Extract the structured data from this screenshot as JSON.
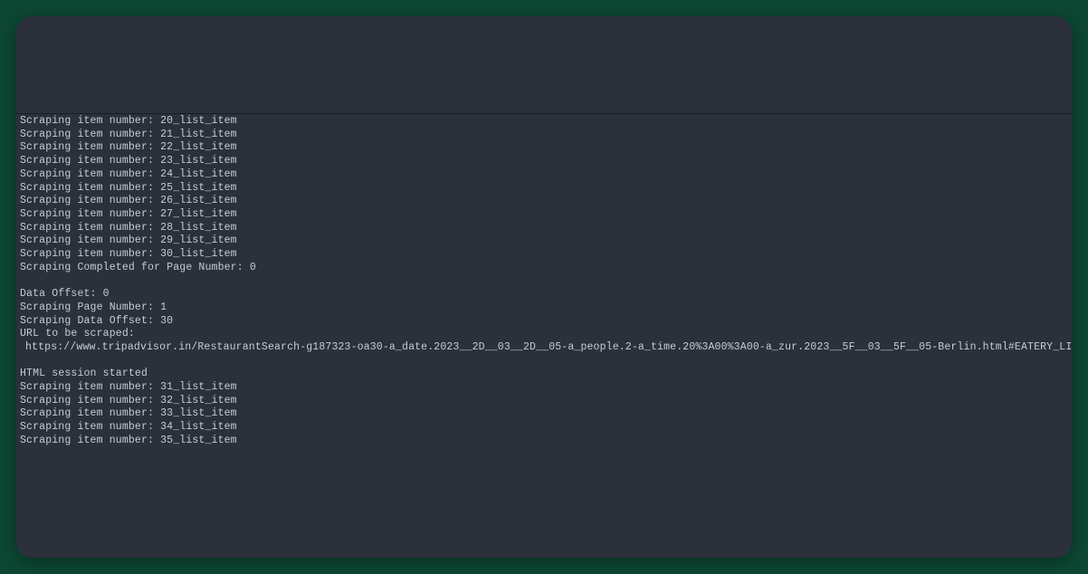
{
  "terminal": {
    "lines": [
      {
        "text": "Scraping item number: 20_list_item",
        "indent": false
      },
      {
        "text": "Scraping item number: 21_list_item",
        "indent": false
      },
      {
        "text": "Scraping item number: 22_list_item",
        "indent": false
      },
      {
        "text": "Scraping item number: 23_list_item",
        "indent": false
      },
      {
        "text": "Scraping item number: 24_list_item",
        "indent": false
      },
      {
        "text": "Scraping item number: 25_list_item",
        "indent": false
      },
      {
        "text": "Scraping item number: 26_list_item",
        "indent": false
      },
      {
        "text": "Scraping item number: 27_list_item",
        "indent": false
      },
      {
        "text": "Scraping item number: 28_list_item",
        "indent": false
      },
      {
        "text": "Scraping item number: 29_list_item",
        "indent": false
      },
      {
        "text": "Scraping item number: 30_list_item",
        "indent": false
      },
      {
        "text": "Scraping Completed for Page Number:  0",
        "indent": false
      },
      {
        "text": "",
        "indent": false,
        "spacer": true
      },
      {
        "text": "Data Offset:  0",
        "indent": false
      },
      {
        "text": "Scraping Page Number:  1",
        "indent": false
      },
      {
        "text": "Scraping Data Offset:  30",
        "indent": false
      },
      {
        "text": "URL to be scraped:",
        "indent": false
      },
      {
        "text": "https://www.tripadvisor.in/RestaurantSearch-g187323-oa30-a_date.2023__2D__03__2D__05-a_people.2-a_time.20%3A00%3A00-a_zur.2023__5F__03__5F__05-Berlin.html#EATERY_LIST_CONTENTS",
        "indent": true
      },
      {
        "text": "",
        "indent": false,
        "spacer": true
      },
      {
        "text": "HTML session started",
        "indent": false
      },
      {
        "text": "Scraping item number: 31_list_item",
        "indent": false
      },
      {
        "text": "Scraping item number: 32_list_item",
        "indent": false
      },
      {
        "text": "Scraping item number: 33_list_item",
        "indent": false
      },
      {
        "text": "Scraping item number: 34_list_item",
        "indent": false
      },
      {
        "text": "Scraping item number: 35_list_item",
        "indent": false
      }
    ]
  }
}
